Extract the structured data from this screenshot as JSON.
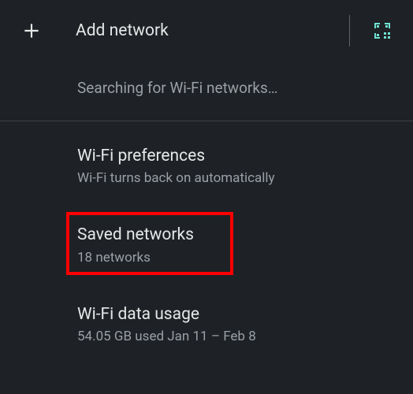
{
  "header": {
    "add_label": "Add network"
  },
  "status": {
    "searching": "Searching for Wi-Fi networks…"
  },
  "items": [
    {
      "title": "Wi-Fi preferences",
      "subtitle": "Wi-Fi turns back on automatically"
    },
    {
      "title": "Saved networks",
      "subtitle": "18 networks"
    },
    {
      "title": "Wi-Fi data usage",
      "subtitle": "54.05 GB used Jan 11 – Feb 8"
    }
  ]
}
